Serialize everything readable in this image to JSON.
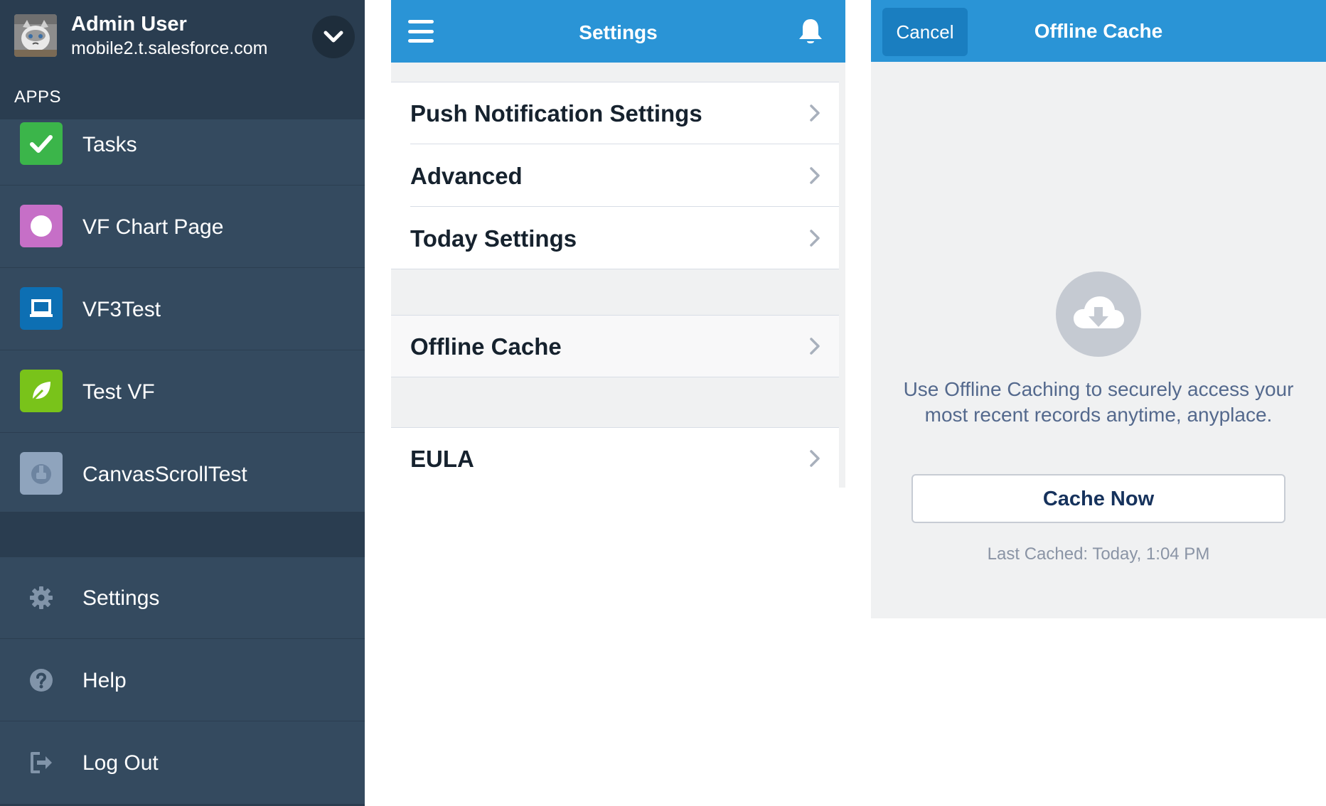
{
  "drawer": {
    "user_name": "Admin User",
    "user_org": "mobile2.t.salesforce.com",
    "apps_label": "APPS",
    "apps": [
      {
        "label": "Tasks",
        "icon": "checkmark-icon",
        "color": "#3bb54a"
      },
      {
        "label": "VF Chart Page",
        "icon": "circle-icon",
        "color": "#c66fc7"
      },
      {
        "label": "VF3Test",
        "icon": "laptop-icon",
        "color": "#0d6fb3"
      },
      {
        "label": "Test VF",
        "icon": "leaf-icon",
        "color": "#79c31a"
      },
      {
        "label": "CanvasScrollTest",
        "icon": "canvas-icon",
        "color": "#8fa4bd"
      }
    ],
    "utilities": [
      {
        "label": "Settings",
        "icon": "gear-icon"
      },
      {
        "label": "Help",
        "icon": "question-icon"
      },
      {
        "label": "Log Out",
        "icon": "logout-icon"
      }
    ]
  },
  "settings": {
    "title": "Settings",
    "rows": [
      {
        "label": "Push Notification Settings"
      },
      {
        "label": "Advanced"
      },
      {
        "label": "Today Settings"
      },
      {
        "label": "Offline Cache"
      },
      {
        "label": "EULA"
      }
    ]
  },
  "offline_cache": {
    "cancel_label": "Cancel",
    "title": "Offline Cache",
    "description": "Use Offline Caching to securely access your most recent records anytime, anyplace.",
    "cache_now_label": "Cache Now",
    "last_cached": "Last Cached: Today, 1:04 PM"
  },
  "colors": {
    "drawer_bg": "#344a5f",
    "header_blue": "#2a94d6",
    "panel_bg": "#f0f1f2"
  }
}
